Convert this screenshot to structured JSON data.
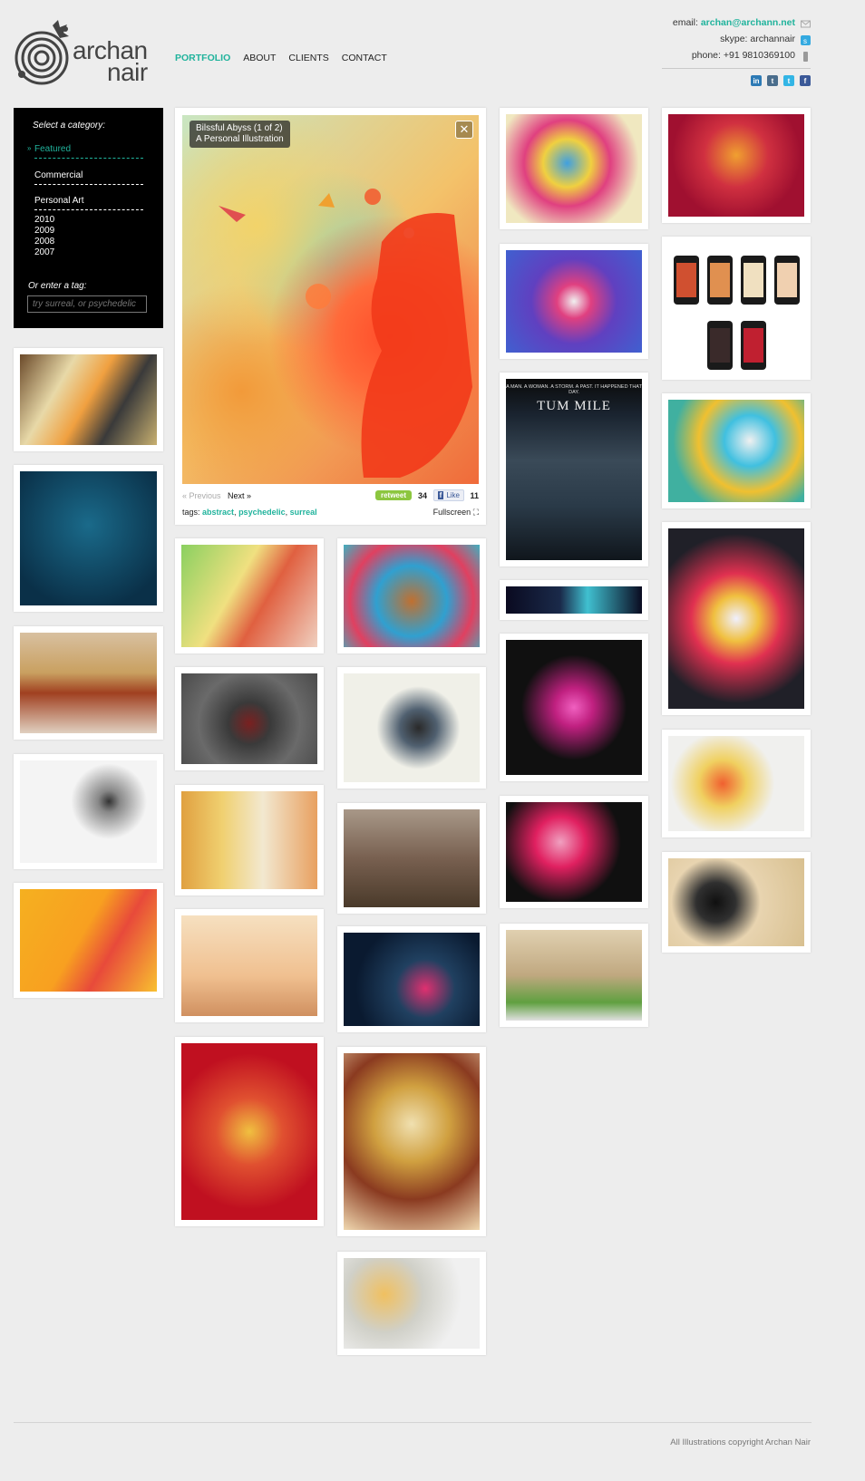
{
  "logo": {
    "line1": "archan",
    "line2": "nair"
  },
  "nav": {
    "items": [
      "PORTFOLIO",
      "ABOUT",
      "CLIENTS",
      "CONTACT"
    ]
  },
  "contact": {
    "email_label": "email:",
    "email": "archan@archann.net",
    "skype": "skype: archannair",
    "phone": "phone: +91 9810369100"
  },
  "social": [
    "in",
    "t",
    "t",
    "f"
  ],
  "categories": {
    "heading": "Select a category:",
    "featured": "Featured",
    "commercial": "Commercial",
    "personal": "Personal Art",
    "years": [
      "2010",
      "2009",
      "2008",
      "2007"
    ],
    "tag_label": "Or enter a tag:",
    "tag_placeholder": "try surreal, or psychedelic"
  },
  "feature": {
    "title": "Bilssful Abyss (1 of 2)",
    "subtitle": "A Personal Illustration",
    "prev": "« Previous",
    "next": "Next  »",
    "retweet": "retweet",
    "retweet_count": "34",
    "like": "Like",
    "like_count": "11",
    "tags_label": "tags:",
    "tags": [
      "abstract",
      "psychedelic",
      "surreal"
    ],
    "fullscreen": "Fullscreen"
  },
  "poster": {
    "tagline": "A MAN. A WOMAN. A STORM. A PAST. IT HAPPENED THAT DAY.",
    "title": "TUM MILE"
  },
  "footer": "All Illustrations copyright Archan Nair",
  "colors": {
    "accent": "#20b39c",
    "background": "#ededed"
  }
}
